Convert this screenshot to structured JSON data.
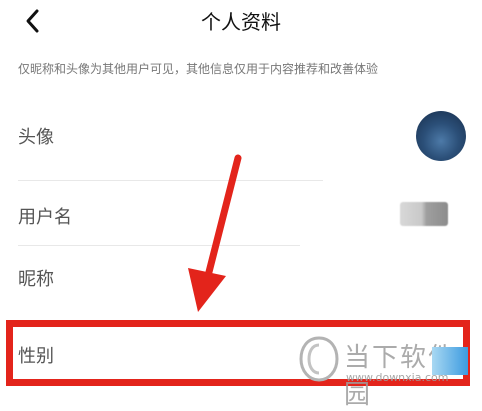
{
  "header": {
    "title": "个人资料"
  },
  "notice": "仅昵称和头像为其他用户可见，其他信息仅用于内容推荐和改善体验",
  "rows": [
    {
      "label": "头像"
    },
    {
      "label": "用户名"
    },
    {
      "label": "昵称"
    },
    {
      "label": "性别"
    }
  ],
  "colors": {
    "highlight": "#e3241b",
    "arrow": "#e3241b"
  },
  "watermark": {
    "cn": "当下软件园",
    "en": "www.downxia.com"
  }
}
